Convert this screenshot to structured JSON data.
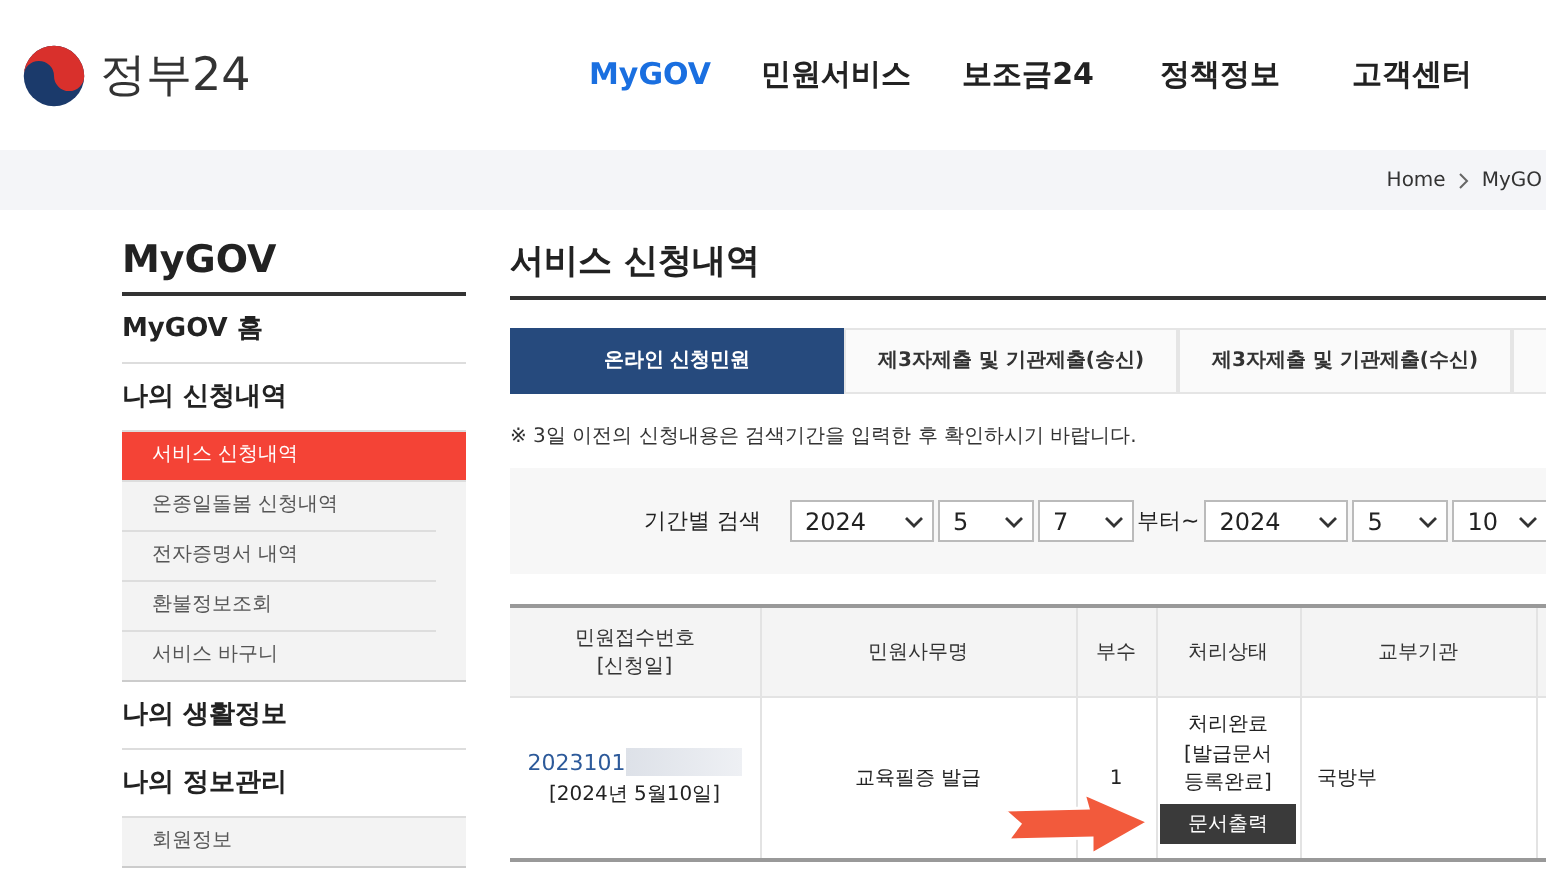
{
  "header": {
    "logo_text": "정부24",
    "nav": [
      {
        "label": "MyGOV",
        "selected": true
      },
      {
        "label": "민원서비스",
        "selected": false
      },
      {
        "label": "보조금24",
        "selected": false
      },
      {
        "label": "정책정보",
        "selected": false
      },
      {
        "label": "고객센터",
        "selected": false
      }
    ]
  },
  "breadcrumb": [
    "Home",
    "MyGO"
  ],
  "sidebar": {
    "title": "MyGOV",
    "items": [
      {
        "label": "MyGOV 홈"
      },
      {
        "label": "나의 신청내역",
        "children": [
          {
            "label": "서비스 신청내역",
            "selected": true
          },
          {
            "label": "온종일돌봄 신청내역",
            "selected": false
          },
          {
            "label": "전자증명서 내역",
            "selected": false
          },
          {
            "label": "환불정보조회",
            "selected": false
          },
          {
            "label": "서비스 바구니",
            "selected": false
          }
        ]
      },
      {
        "label": "나의 생활정보"
      },
      {
        "label": "나의 정보관리",
        "children": [
          {
            "label": "회원정보",
            "selected": false
          }
        ]
      }
    ]
  },
  "main": {
    "title": "서비스 신청내역",
    "tabs": [
      {
        "label": "온라인 신청민원",
        "selected": true
      },
      {
        "label": "제3자제출 및 기관제출(송신)",
        "selected": false
      },
      {
        "label": "제3자제출 및 기관제출(수신)",
        "selected": false
      }
    ],
    "notice": "※ 3일 이전의 신청내용은 검색기간을 입력한 후 확인하시기 바랍니다.",
    "search": {
      "label": "기간별 검색",
      "from": [
        "2024",
        "5",
        "7"
      ],
      "between": "부터~",
      "to": [
        "2024",
        "5",
        "10"
      ]
    },
    "table": {
      "columns": [
        "민원접수번호\n[신청일]",
        "민원사무명",
        "부수",
        "처리상태",
        "교부기관"
      ],
      "rows": [
        {
          "receipt_no": "2023101",
          "redacted": true,
          "date": "[2024년 5월10일]",
          "name": "교육필증 발급",
          "copies": "1",
          "status_lines": [
            "처리완료",
            "[발급문서",
            "등록완료]"
          ],
          "action": "문서출력",
          "agency": "국방부"
        }
      ]
    }
  }
}
